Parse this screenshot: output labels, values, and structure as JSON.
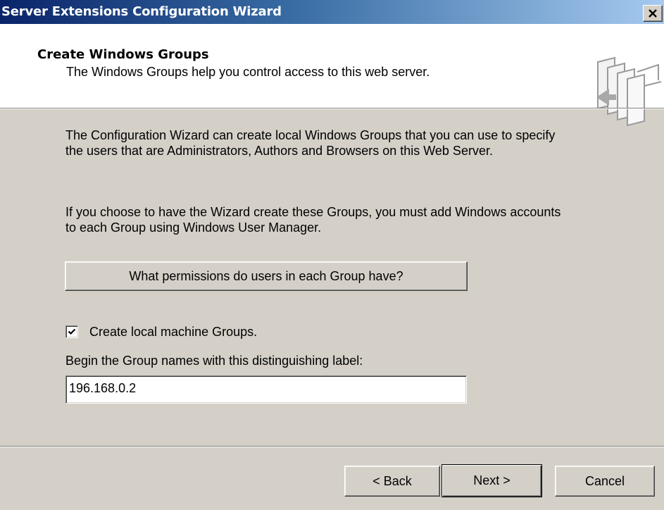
{
  "window": {
    "title": "Server Extensions Configuration Wizard",
    "close_glyph": "×"
  },
  "header": {
    "title": "Create Windows Groups",
    "subtitle": "The Windows Groups help you control access to this web server.",
    "icon": "wizard-pages-icon"
  },
  "body": {
    "paragraph1_line1": "The Configuration Wizard can create local Windows Groups that you can use to specify",
    "paragraph1_line2": "the users that are Administrators, Authors and Browsers on this Web Server.",
    "paragraph2_line1": "If you choose to have the Wizard create these Groups, you must add Windows accounts",
    "paragraph2_line2": "to each Group using Windows User Manager.",
    "permissions_button_label": "What permissions do users in each Group have?",
    "checkbox": {
      "label": "Create local machine Groups.",
      "checked": true
    },
    "group_label_prompt": "Begin the Group names with this distinguishing label:",
    "group_label_value": "196.168.0.2"
  },
  "footer": {
    "back_label": "< Back",
    "next_label": "Next >",
    "cancel_label": "Cancel"
  },
  "colors": {
    "titlebar_start": "#0a246a",
    "titlebar_end": "#a6caf0",
    "dialog_face": "#d4d0c8",
    "header_bg": "#ffffff"
  }
}
